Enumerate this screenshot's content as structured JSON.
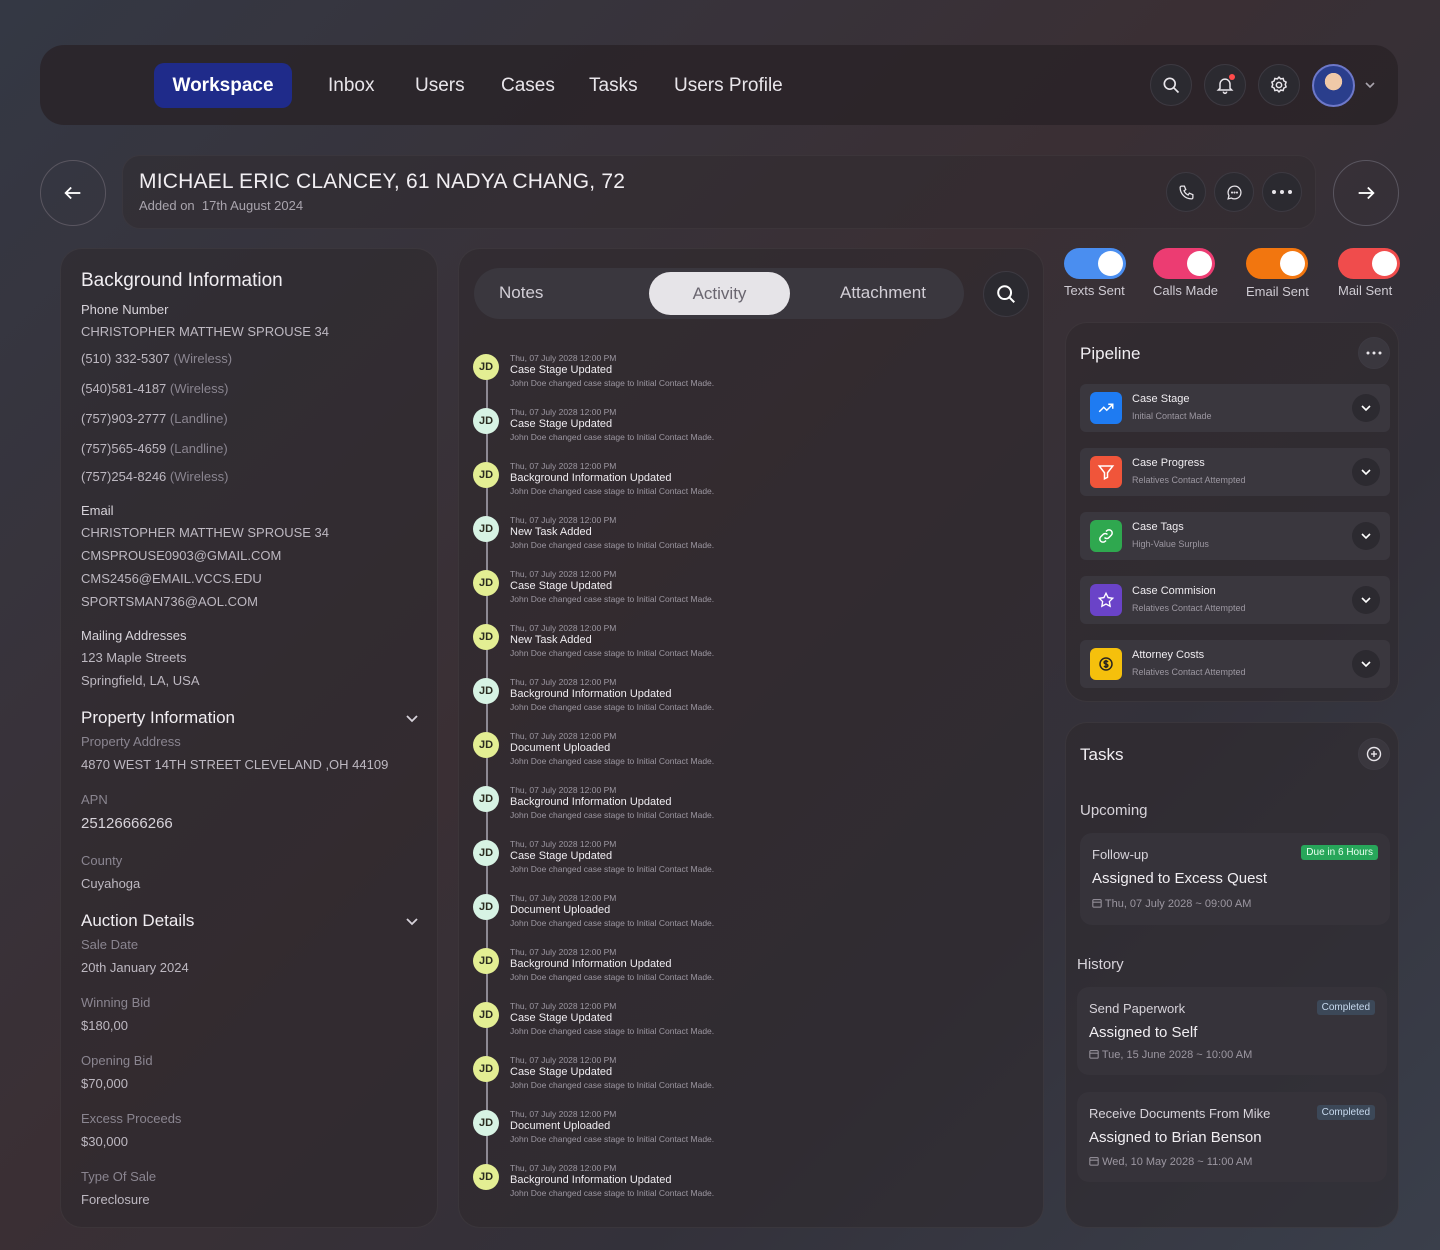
{
  "nav": {
    "items": [
      "Workspace",
      "Inbox",
      "Users",
      "Cases",
      "Tasks",
      "Users Profile"
    ]
  },
  "header": {
    "title": "MICHAEL ERIC CLANCEY, 61 NADYA CHANG, 72",
    "added_label": "Added on",
    "added_date": "17th August 2024"
  },
  "background": {
    "heading": "Background Information",
    "phone_label": "Phone Number",
    "phone_owner": "CHRISTOPHER MATTHEW SPROUSE 34",
    "phones": [
      {
        "number": "(510) 332-5307",
        "type": "(Wireless)"
      },
      {
        "number": "(540)581-4187",
        "type": "(Wireless)"
      },
      {
        "number": "(757)903-2777",
        "type": "(Landline)"
      },
      {
        "number": "(757)565-4659",
        "type": "(Landline)"
      },
      {
        "number": "(757)254-8246",
        "type": "(Wireless)"
      }
    ],
    "email_label": "Email",
    "email_owner": "CHRISTOPHER MATTHEW SPROUSE 34",
    "emails": [
      "CMSPROUSE0903@GMAIL.COM",
      "CMS2456@EMAIL.VCCS.EDU",
      "SPORTSMAN736@AOL.COM"
    ],
    "mailing_label": "Mailing Addresses",
    "mailing_line1": "123 Maple Streets",
    "mailing_line2": "Springfield, LA, USA"
  },
  "property": {
    "heading": "Property Information",
    "address_label": "Property Address",
    "address": "4870 WEST 14TH STREET CLEVELAND ,OH 44109",
    "apn_label": "APN",
    "apn": "25126666266",
    "county_label": "County",
    "county": "Cuyahoga"
  },
  "auction": {
    "heading": "Auction Details",
    "fields": [
      {
        "label": "Sale Date",
        "value": "20th January 2024"
      },
      {
        "label": "Winning Bid",
        "value": "$180,00"
      },
      {
        "label": "Opening Bid",
        "value": "$70,000"
      },
      {
        "label": "Excess Proceeds",
        "value": "$30,000"
      },
      {
        "label": "Type Of Sale",
        "value": "Foreclosure"
      }
    ]
  },
  "tabs": {
    "notes": "Notes",
    "activity": "Activity",
    "attachment": "Attachment"
  },
  "activity": [
    {
      "initials": "JD",
      "date": "Thu, 07 July 2028  12:00 PM",
      "title": "Case Stage Updated",
      "desc": "John Doe changed case stage to Initial Contact Made.",
      "color": "#e3ee93"
    },
    {
      "initials": "JD",
      "date": "Thu, 07 July 2028  12:00 PM",
      "title": "Case Stage Updated",
      "desc": "John Doe changed case stage to Initial Contact Made.",
      "color": "#d7f3e4"
    },
    {
      "initials": "JD",
      "date": "Thu, 07 July 2028  12:00 PM",
      "title": "Background Information Updated",
      "desc": "John Doe changed case stage to Initial Contact Made.",
      "color": "#e3ee93"
    },
    {
      "initials": "JD",
      "date": "Thu, 07 July 2028  12:00 PM",
      "title": "New Task Added",
      "desc": "John Doe changed case stage to Initial Contact Made.",
      "color": "#d7f3e4"
    },
    {
      "initials": "JD",
      "date": "Thu, 07 July 2028  12:00 PM",
      "title": "Case Stage Updated",
      "desc": "John Doe changed case stage to Initial Contact Made.",
      "color": "#e3ee93"
    },
    {
      "initials": "JD",
      "date": "Thu, 07 July 2028  12:00 PM",
      "title": "New Task Added",
      "desc": "John Doe changed case stage to Initial Contact Made.",
      "color": "#e3ee93"
    },
    {
      "initials": "JD",
      "date": "Thu, 07 July 2028  12:00 PM",
      "title": "Background Information Updated",
      "desc": "John Doe changed case stage to Initial Contact Made.",
      "color": "#d7f3e4"
    },
    {
      "initials": "JD",
      "date": "Thu, 07 July 2028  12:00 PM",
      "title": "Document Uploaded",
      "desc": "John Doe changed case stage to Initial Contact Made.",
      "color": "#e3ee93"
    },
    {
      "initials": "JD",
      "date": "Thu, 07 July 2028  12:00 PM",
      "title": "Background Information Updated",
      "desc": "John Doe changed case stage to Initial Contact Made.",
      "color": "#d7f3e4"
    },
    {
      "initials": "JD",
      "date": "Thu, 07 July 2028  12:00 PM",
      "title": "Case Stage Updated",
      "desc": "John Doe changed case stage to Initial Contact Made.",
      "color": "#d7f3e4"
    },
    {
      "initials": "JD",
      "date": "Thu, 07 July 2028  12:00 PM",
      "title": "Document Uploaded",
      "desc": "John Doe changed case stage to Initial Contact Made.",
      "color": "#d7f3e4"
    },
    {
      "initials": "JD",
      "date": "Thu, 07 July 2028  12:00 PM",
      "title": "Background Information Updated",
      "desc": "John Doe changed case stage to Initial Contact Made.",
      "color": "#e3ee93"
    },
    {
      "initials": "JD",
      "date": "Thu, 07 July 2028  12:00 PM",
      "title": "Case Stage Updated",
      "desc": "John Doe changed case stage to Initial Contact Made.",
      "color": "#e3ee93"
    },
    {
      "initials": "JD",
      "date": "Thu, 07 July 2028  12:00 PM",
      "title": "Case Stage Updated",
      "desc": "John Doe changed case stage to Initial Contact Made.",
      "color": "#e3ee93"
    },
    {
      "initials": "JD",
      "date": "Thu, 07 July 2028  12:00 PM",
      "title": "Document Uploaded",
      "desc": "John Doe changed case stage to Initial Contact Made.",
      "color": "#d7f3e4"
    },
    {
      "initials": "JD",
      "date": "Thu, 07 July 2028  12:00 PM",
      "title": "Background Information Updated",
      "desc": "John Doe changed case stage to Initial Contact Made.",
      "color": "#e3ee93"
    }
  ],
  "toggles": [
    {
      "label": "Texts Sent",
      "color": "#4a8ef0",
      "on": true
    },
    {
      "label": "Calls Made",
      "color": "#ec3c72",
      "on": true
    },
    {
      "label": "Email Sent",
      "color": "#f2760f",
      "on": true
    },
    {
      "label": "Mail Sent",
      "color": "#f04c4c",
      "on": true
    }
  ],
  "pipeline": {
    "heading": "Pipeline",
    "rows": [
      {
        "title": "Case Stage",
        "sub": "Initial Contact Made",
        "icon": "trend-up-icon",
        "color": "#1e7bf2"
      },
      {
        "title": "Case Progress",
        "sub": "Relatives Contact Attempted",
        "icon": "filter-icon",
        "color": "#f0553a"
      },
      {
        "title": "Case Tags",
        "sub": "High-Value Surplus",
        "icon": "link-icon",
        "color": "#2fa84f"
      },
      {
        "title": "Case Commision",
        "sub": "Relatives Contact Attempted",
        "icon": "star-icon",
        "color": "#6a43c8"
      },
      {
        "title": "Attorney Costs",
        "sub": "Relatives Contact Attempted",
        "icon": "dollar-icon",
        "color": "#f5c00c"
      }
    ]
  },
  "tasks": {
    "heading": "Tasks",
    "upcoming_label": "Upcoming",
    "upcoming": {
      "type": "Follow-up",
      "badge": "Due in 6 Hours",
      "title": "Assigned to Excess Quest",
      "date": "Thu, 07 July 2028",
      "time": "09:00 AM"
    },
    "history_label": "History",
    "history": [
      {
        "type": "Send Paperwork",
        "badge": "Completed",
        "title": "Assigned to Self",
        "date": "Tue, 15 June 2028",
        "time": "10:00 AM"
      },
      {
        "type": "Receive Documents From Mike",
        "badge": "Completed",
        "title": "Assigned to Brian Benson",
        "date": "Wed, 10 May 2028",
        "time": "11:00 AM"
      }
    ],
    "separator": "~"
  }
}
